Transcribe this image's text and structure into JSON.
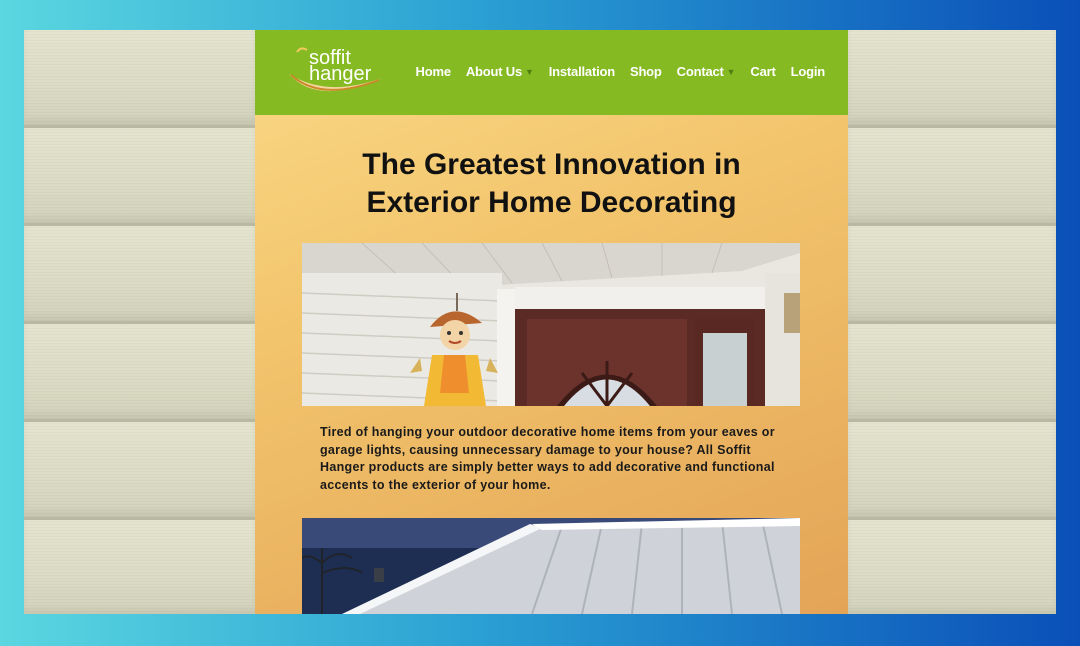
{
  "logo": {
    "line1": "soffit",
    "line2": "hanger"
  },
  "nav": {
    "items": [
      {
        "label": "Home",
        "dropdown": false
      },
      {
        "label": "About Us",
        "dropdown": true
      },
      {
        "label": "Installation",
        "dropdown": false
      },
      {
        "label": "Shop",
        "dropdown": false
      },
      {
        "label": "Contact",
        "dropdown": true
      },
      {
        "label": "Cart",
        "dropdown": false
      },
      {
        "label": "Login",
        "dropdown": false
      }
    ]
  },
  "hero": {
    "title_line1": "The Greatest Innovation in",
    "title_line2": "Exterior Home Decorating"
  },
  "description": "Tired of hanging your outdoor decorative home items from your eaves or garage lights, causing unnecessary damage to your house? All Soffit Hanger products are simply better ways to add decorative and functional accents to the exterior of your home.",
  "colors": {
    "header_green": "#86ba22",
    "background_gradient_start": "#5ad7e0",
    "background_gradient_end": "#0a4fb8",
    "panel_gold": "#f2c46c"
  }
}
